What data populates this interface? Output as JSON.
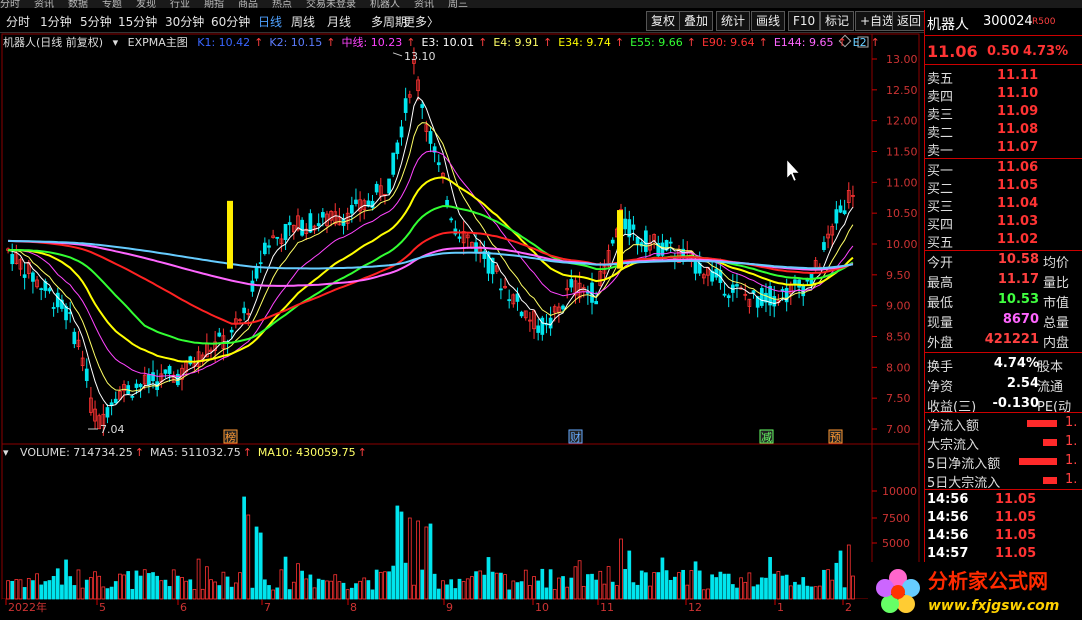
{
  "topmenu": [
    "分时",
    "资讯",
    "数据",
    "专题",
    "发现",
    "行业",
    "期指",
    "商品",
    "热点",
    "交易未登录",
    "机器人",
    "资讯",
    "周三"
  ],
  "toolbar": {
    "periods": [
      "分时",
      "1分钟",
      "5分钟",
      "15分钟",
      "30分钟",
      "60分钟",
      "日线",
      "周线",
      "月线",
      "多周期",
      "更多〉"
    ],
    "active": "日线",
    "buttons": [
      "复权",
      "叠加",
      "统计",
      "画线",
      "F10",
      "标记",
      "+自选",
      "返回"
    ]
  },
  "chart": {
    "header": "机器人(日线 前复权)",
    "indicator": "EXPMA主图",
    "ma_labels": [
      {
        "text": "K1: 10.42",
        "color": "#3a66ff"
      },
      {
        "text": "K2: 10.15",
        "color": "#5d7dff"
      },
      {
        "text": "中线: 10.23",
        "color": "#ff44ff"
      },
      {
        "text": "E3: 10.01",
        "color": "#ffffff"
      },
      {
        "text": "E4: 9.91",
        "color": "#ffff66"
      },
      {
        "text": "E34: 9.74",
        "color": "#ffff00"
      },
      {
        "text": "E55: 9.66",
        "color": "#33ff33"
      },
      {
        "text": "E90: 9.64",
        "color": "#ff3333"
      },
      {
        "text": "E144: 9.65",
        "color": "#ff66ff"
      },
      {
        "text": "E2",
        "color": "#66ccff"
      }
    ],
    "price_axis": [
      "13.00",
      "12.50",
      "12.00",
      "11.50",
      "11.00",
      "10.50",
      "10.00",
      "9.50",
      "9.00",
      "8.50",
      "8.00",
      "7.50",
      "7.00"
    ],
    "high_label": "13.10",
    "low_label": "7.04",
    "markers": [
      {
        "text": "榜",
        "color": "#ff9933"
      },
      {
        "text": "财",
        "color": "#66aaff"
      },
      {
        "text": "减",
        "color": "#66ff66"
      },
      {
        "text": "预",
        "color": "#ff9933"
      }
    ],
    "volume_labels": [
      {
        "text": "VOLUME: 714734.25",
        "color": "#dddddd"
      },
      {
        "text": "MA5: 511032.75",
        "color": "#dddddd"
      },
      {
        "text": "MA10: 430059.75",
        "color": "#ffff66"
      }
    ],
    "volume_axis": [
      "10000",
      "7500",
      "5000"
    ],
    "date_axis": [
      "2022年",
      "5",
      "6",
      "7",
      "8",
      "9",
      "10",
      "11",
      "12",
      "1",
      "2"
    ]
  },
  "quote": {
    "name": "机器人",
    "code": "300024",
    "tag": "R500",
    "price": "11.06",
    "change": "0.50",
    "pct": "4.73%",
    "asks": [
      {
        "label": "卖五",
        "price": "11.11"
      },
      {
        "label": "卖四",
        "price": "11.10"
      },
      {
        "label": "卖三",
        "price": "11.09"
      },
      {
        "label": "卖二",
        "price": "11.08"
      },
      {
        "label": "卖一",
        "price": "11.07"
      }
    ],
    "bids": [
      {
        "label": "买一",
        "price": "11.06"
      },
      {
        "label": "买二",
        "price": "11.05"
      },
      {
        "label": "买三",
        "price": "11.04"
      },
      {
        "label": "买四",
        "price": "11.03"
      },
      {
        "label": "买五",
        "price": "11.02"
      }
    ],
    "stats": [
      {
        "k": "今开",
        "v": "10.58",
        "c": "#ff4040",
        "k2": "均价"
      },
      {
        "k": "最高",
        "v": "11.17",
        "c": "#ff4040",
        "k2": "量比"
      },
      {
        "k": "最低",
        "v": "10.53",
        "c": "#40ff40",
        "k2": "市值"
      },
      {
        "k": "现量",
        "v": "8670",
        "c": "#ff66ff",
        "k2": "总量"
      },
      {
        "k": "外盘",
        "v": "421221",
        "c": "#ff4040",
        "k2": "内盘"
      }
    ],
    "stats2": [
      {
        "k": "换手",
        "v": "4.74%",
        "c": "#ffffff",
        "k2": "股本"
      },
      {
        "k": "净资",
        "v": "2.54",
        "c": "#ffffff",
        "k2": "流通"
      },
      {
        "k": "收益(三)",
        "v": "-0.130",
        "c": "#ffffff",
        "k2": "PE(动"
      }
    ],
    "flows": [
      {
        "k": "净流入额",
        "v": "1."
      },
      {
        "k": "大宗流入",
        "v": "1."
      },
      {
        "k": "5日净流入额",
        "v": "1."
      },
      {
        "k": "5日大宗流入",
        "v": "1."
      }
    ],
    "ticks": [
      {
        "t": "14:56",
        "p": "11.05"
      },
      {
        "t": "14:56",
        "p": "11.05"
      },
      {
        "t": "14:56",
        "p": "11.05"
      },
      {
        "t": "14:57",
        "p": "11.05"
      }
    ]
  },
  "logo": {
    "title": "分析家公式网",
    "url": "www.fxjgsw.com"
  }
}
